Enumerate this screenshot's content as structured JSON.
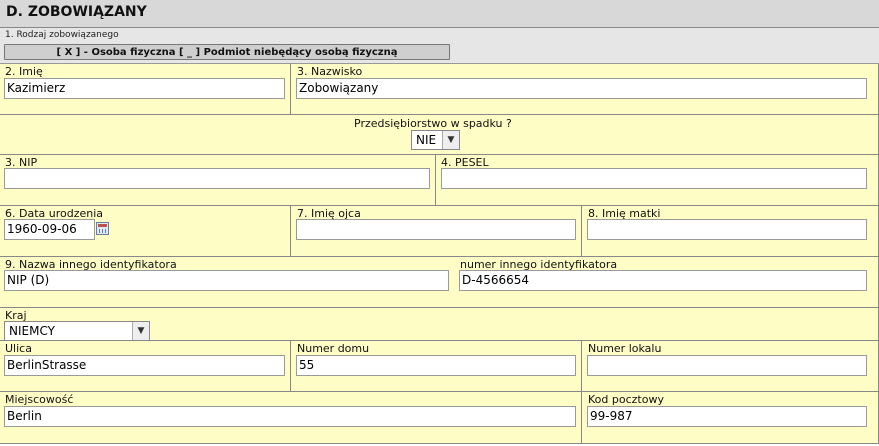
{
  "section": {
    "title": "D. ZOBOWIĄZANY"
  },
  "type": {
    "label": "1. Rodzaj zobowiązanego",
    "toggle_label": "[ X ] - Osoba fizyczna [ _ ] Podmiot niebędący osobą fizyczną"
  },
  "fields": {
    "first_name": {
      "label": "2. Imię",
      "value": "Kazimierz"
    },
    "last_name": {
      "label": "3. Nazwisko",
      "value": "Zobowiązany"
    },
    "inheritance": {
      "label": "Przedsiębiorstwo w spadku ?",
      "value": "NIE"
    },
    "nip": {
      "label": "3. NIP",
      "value": ""
    },
    "pesel": {
      "label": "4. PESEL",
      "value": ""
    },
    "birth_date": {
      "label": "6. Data urodzenia",
      "value": "1960-09-06"
    },
    "father_name": {
      "label": "7. Imię ojca",
      "value": ""
    },
    "mother_name": {
      "label": "8. Imię matki",
      "value": ""
    },
    "other_id_name": {
      "label": "9. Nazwa innego identyfikatora",
      "value": "NIP (D)"
    },
    "other_id_number": {
      "label": "numer innego identyfikatora",
      "value": "D-4566654"
    },
    "country": {
      "label": "Kraj",
      "value": "NIEMCY"
    },
    "street": {
      "label": "Ulica",
      "value": "BerlinStrasse"
    },
    "house_number": {
      "label": "Numer domu",
      "value": "55"
    },
    "apartment_number": {
      "label": "Numer lokalu",
      "value": ""
    },
    "city": {
      "label": "Miejscowość",
      "value": "Berlin"
    },
    "postal_code": {
      "label": "Kod pocztowy",
      "value": "99-987"
    }
  }
}
